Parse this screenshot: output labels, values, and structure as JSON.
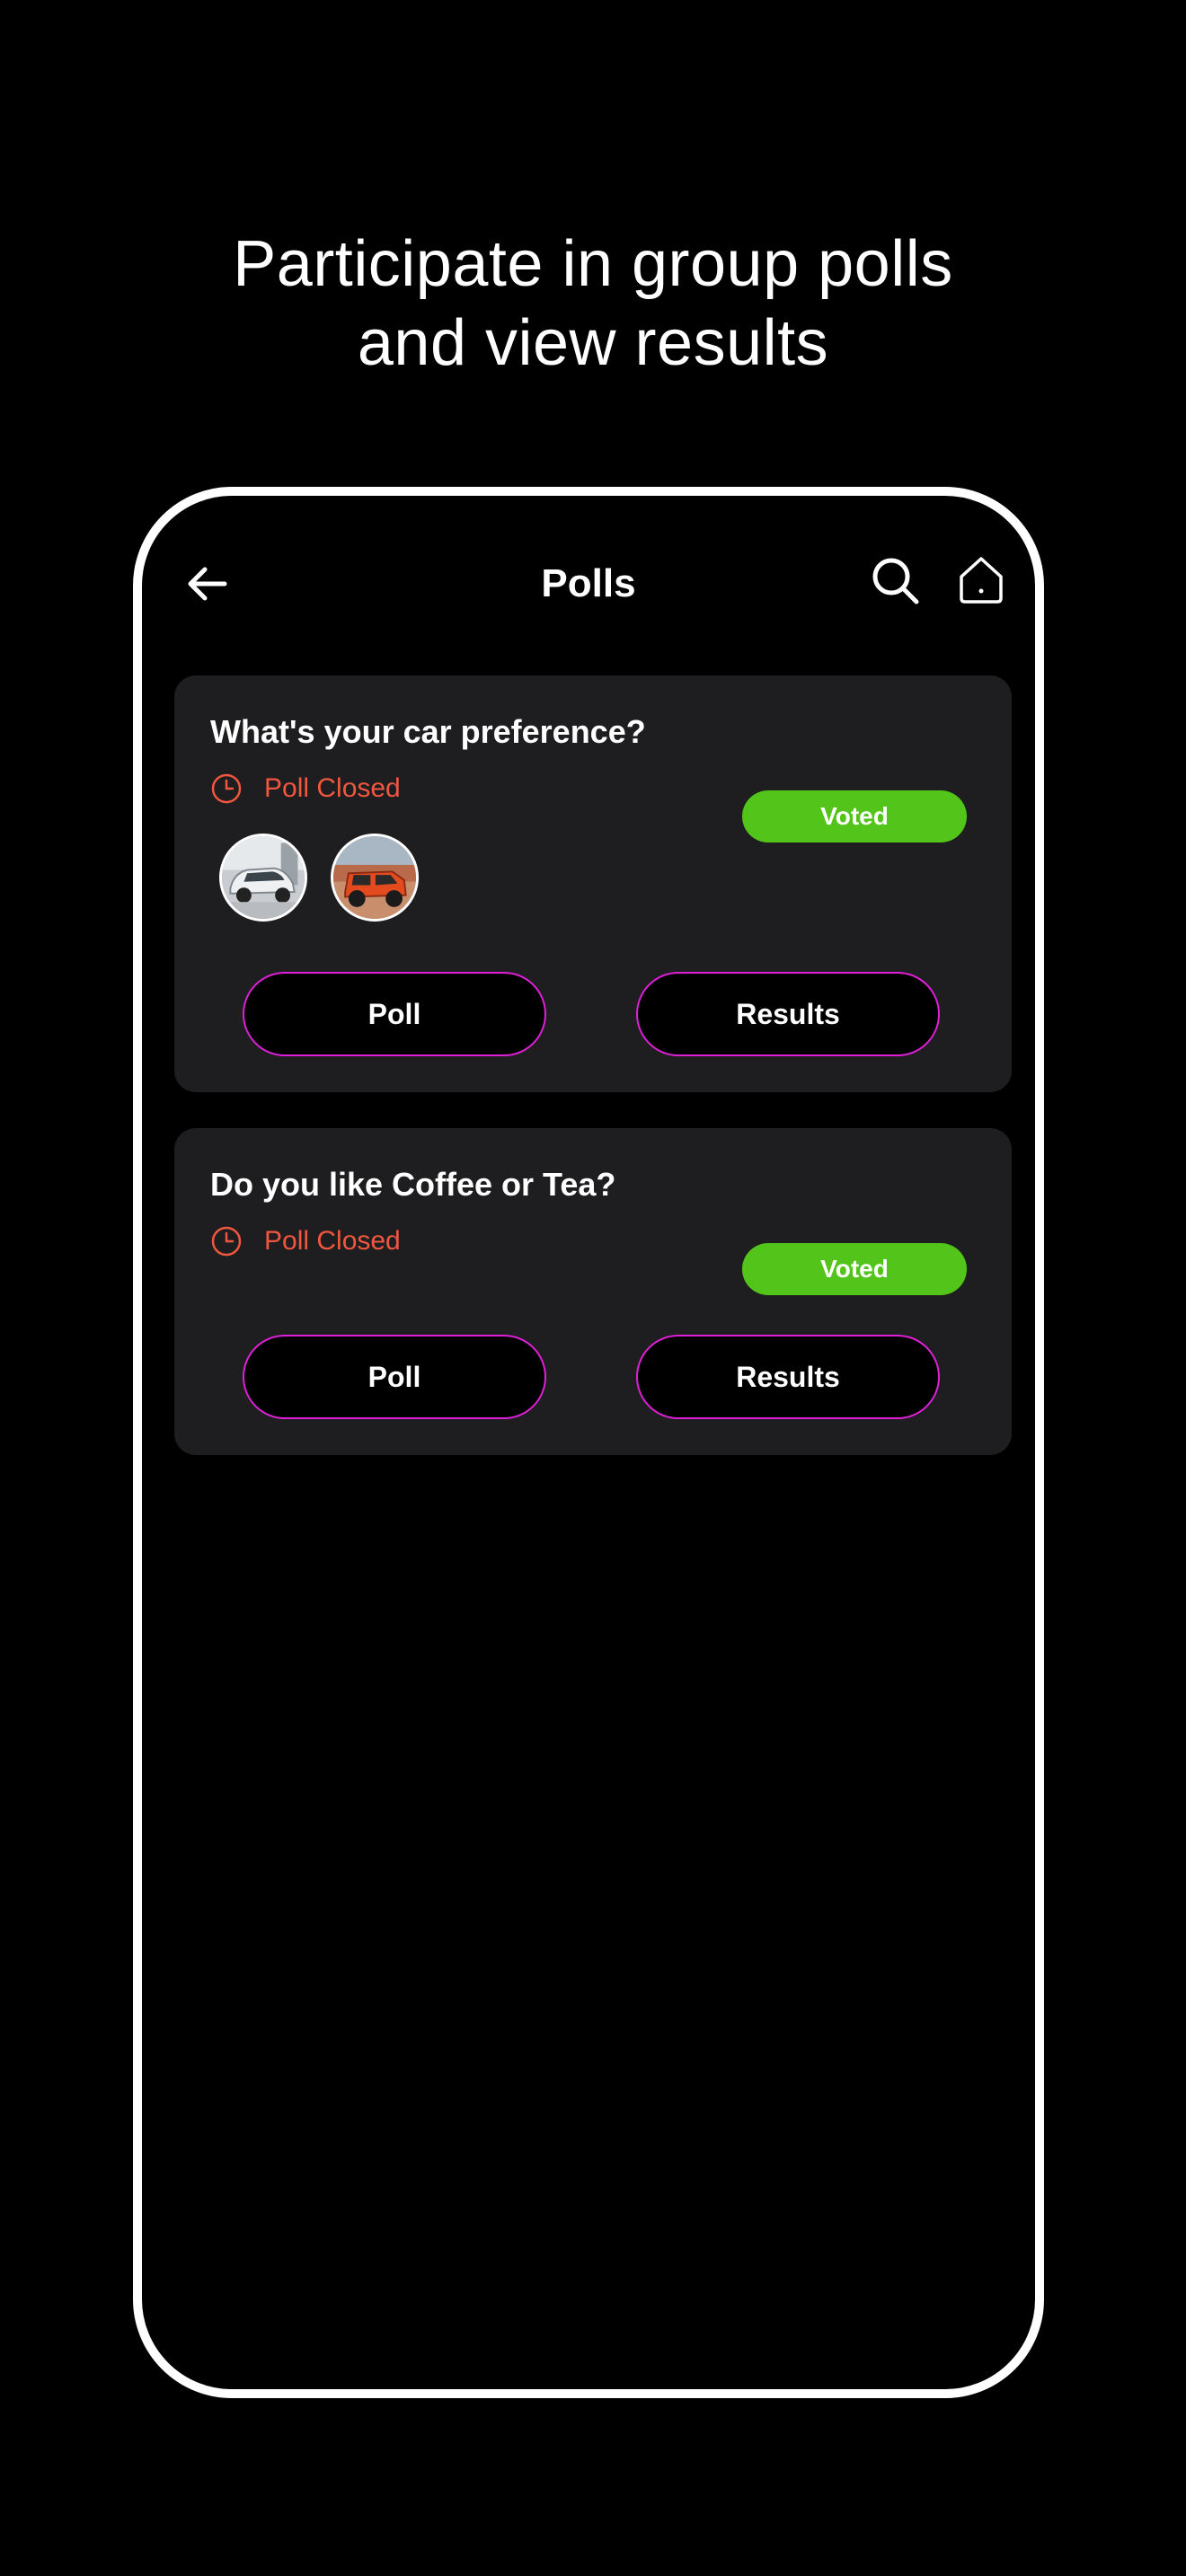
{
  "headline": {
    "line1": "Participate in group polls",
    "line2": "and view results"
  },
  "appbar": {
    "title": "Polls",
    "back_icon": "arrow-left-icon",
    "search_icon": "search-icon",
    "home_icon": "home-icon"
  },
  "polls": [
    {
      "question": "What's your car preference?",
      "status": "Poll Closed",
      "badge": "Voted",
      "options_images": [
        "silver-suv-image",
        "orange-jeep-image"
      ],
      "poll_label": "Poll",
      "results_label": "Results"
    },
    {
      "question": "Do you like Coffee or Tea?",
      "status": "Poll Closed",
      "badge": "Voted",
      "poll_label": "Poll",
      "results_label": "Results"
    }
  ],
  "colors": {
    "background": "#000000",
    "card": "#1e1e20",
    "status_red": "#f0573f",
    "voted_green": "#52c41a",
    "button_border": "#e020d8"
  }
}
